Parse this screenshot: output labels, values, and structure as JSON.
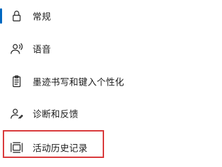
{
  "nav": {
    "items": [
      {
        "label": "常规",
        "icon": "lock-icon"
      },
      {
        "label": "语音",
        "icon": "speech-icon"
      },
      {
        "label": "墨迹书写和键入个性化",
        "icon": "clipboard-pen-icon"
      },
      {
        "label": "诊断和反馈",
        "icon": "person-feedback-icon"
      },
      {
        "label": "活动历史记录",
        "icon": "activity-history-icon"
      }
    ],
    "active_index": 0,
    "highlighted_index": 4
  },
  "colors": {
    "accent": "#0067c0",
    "highlight": "#d9393b",
    "text": "#1a1a1a",
    "background": "#ffffff"
  }
}
